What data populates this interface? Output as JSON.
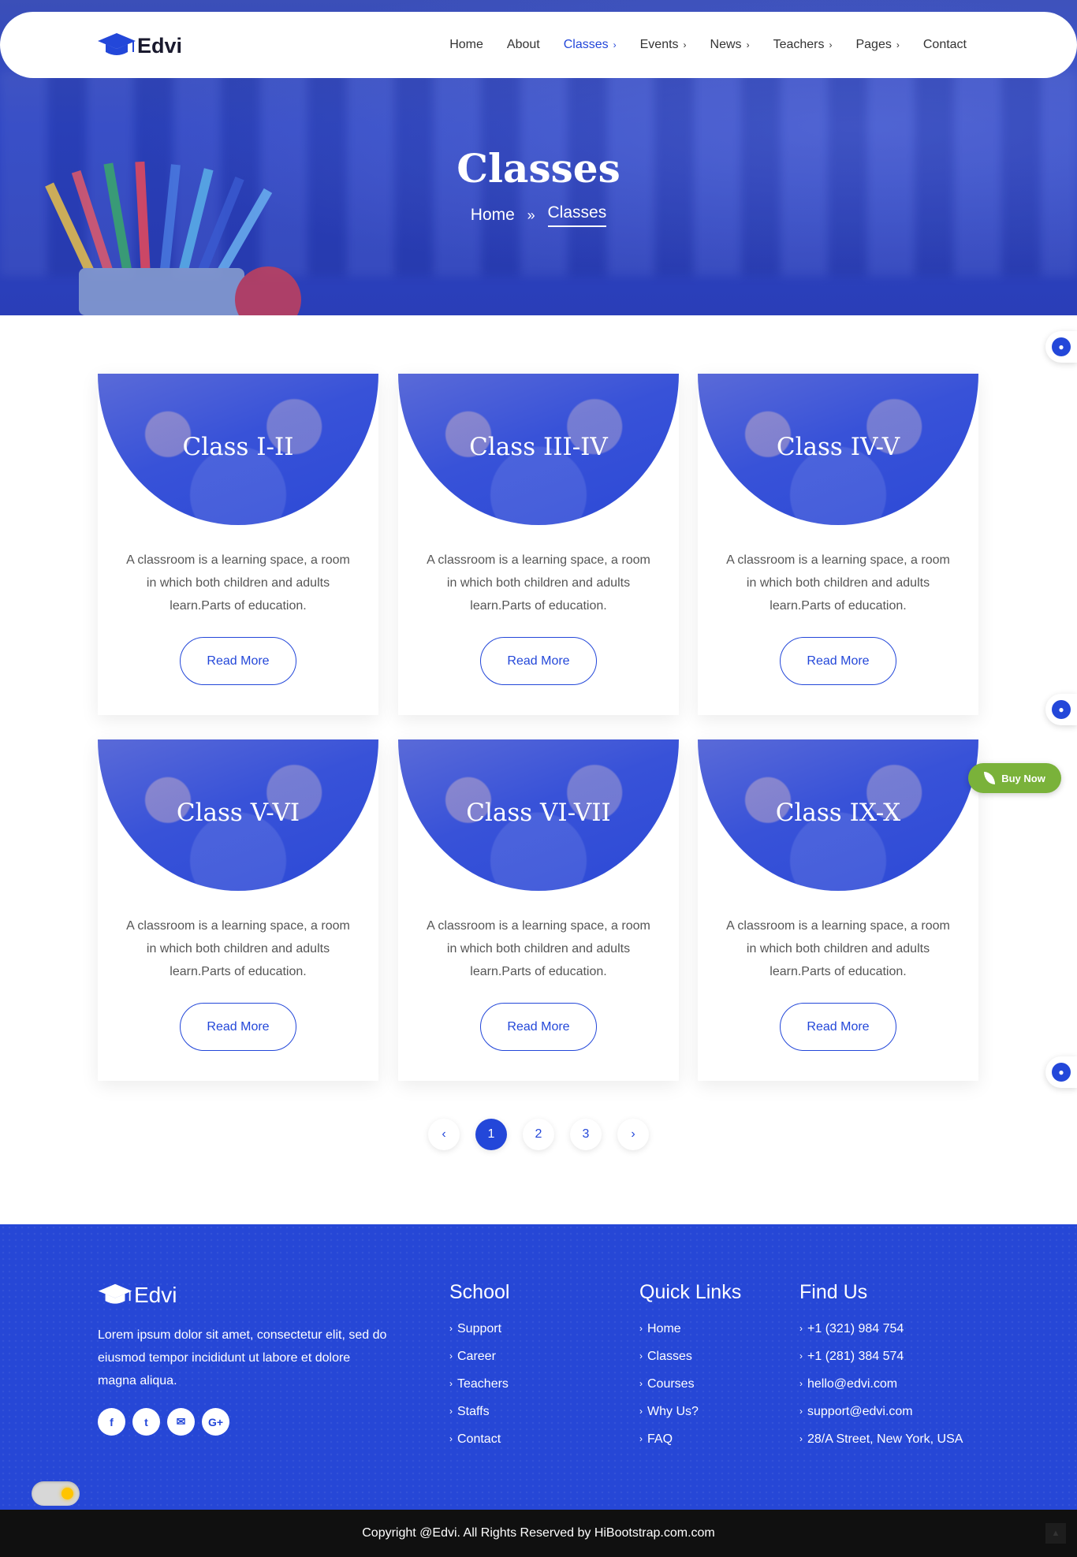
{
  "brand": {
    "name": "Edvi",
    "accent": "#2347d9",
    "footer_bg": "#2647d6"
  },
  "nav": {
    "items": [
      {
        "label": "Home",
        "has_dropdown": false,
        "active": false
      },
      {
        "label": "About",
        "has_dropdown": false,
        "active": false
      },
      {
        "label": "Classes",
        "has_dropdown": true,
        "active": true
      },
      {
        "label": "Events",
        "has_dropdown": true,
        "active": false
      },
      {
        "label": "News",
        "has_dropdown": true,
        "active": false
      },
      {
        "label": "Teachers",
        "has_dropdown": true,
        "active": false
      },
      {
        "label": "Pages",
        "has_dropdown": true,
        "active": false
      },
      {
        "label": "Contact",
        "has_dropdown": false,
        "active": false
      }
    ]
  },
  "hero": {
    "title": "Classes",
    "breadcrumb": {
      "home": "Home",
      "current": "Classes"
    }
  },
  "cards": [
    {
      "title": "Class I-II",
      "text": "A classroom is a learning space, a room in which both children and adults learn.Parts of education.",
      "button": "Read More"
    },
    {
      "title": "Class III-IV",
      "text": "A classroom is a learning space, a room in which both children and adults learn.Parts of education.",
      "button": "Read More"
    },
    {
      "title": "Class IV-V",
      "text": "A classroom is a learning space, a room in which both children and adults learn.Parts of education.",
      "button": "Read More"
    },
    {
      "title": "Class V-VI",
      "text": "A classroom is a learning space, a room in which both children and adults learn.Parts of education.",
      "button": "Read More"
    },
    {
      "title": "Class VI-VII",
      "text": "A classroom is a learning space, a room in which both children and adults learn.Parts of education.",
      "button": "Read More"
    },
    {
      "title": "Class IX-X",
      "text": "A classroom is a learning space, a room in which both children and adults learn.Parts of education.",
      "button": "Read More"
    }
  ],
  "pagination": {
    "pages": [
      "1",
      "2",
      "3"
    ],
    "current": "1",
    "prev_icon": "chevron-left-icon",
    "next_icon": "chevron-right-icon"
  },
  "buy_now": {
    "label": "Buy Now"
  },
  "footer": {
    "logo": "Edvi",
    "about": "Lorem ipsum dolor sit amet, consectetur elit, sed do eiusmod tempor incididunt ut labore et dolore magna aliqua.",
    "social": [
      "facebook-icon",
      "twitter-icon",
      "email-icon",
      "google-plus-icon"
    ],
    "school": {
      "title": "School",
      "links": [
        "Support",
        "Career",
        "Teachers",
        "Staffs",
        "Contact"
      ]
    },
    "quick": {
      "title": "Quick Links",
      "links": [
        "Home",
        "Classes",
        "Courses",
        "Why Us?",
        "FAQ"
      ]
    },
    "find": {
      "title": "Find Us",
      "links": [
        "+1 (321) 984 754",
        "+1 (281) 384 574",
        "hello@edvi.com",
        "support@edvi.com",
        "28/A Street, New York, USA"
      ]
    }
  },
  "copyright": "Copyright @Edvi. All Rights Reserved by HiBootstrap.com.com"
}
